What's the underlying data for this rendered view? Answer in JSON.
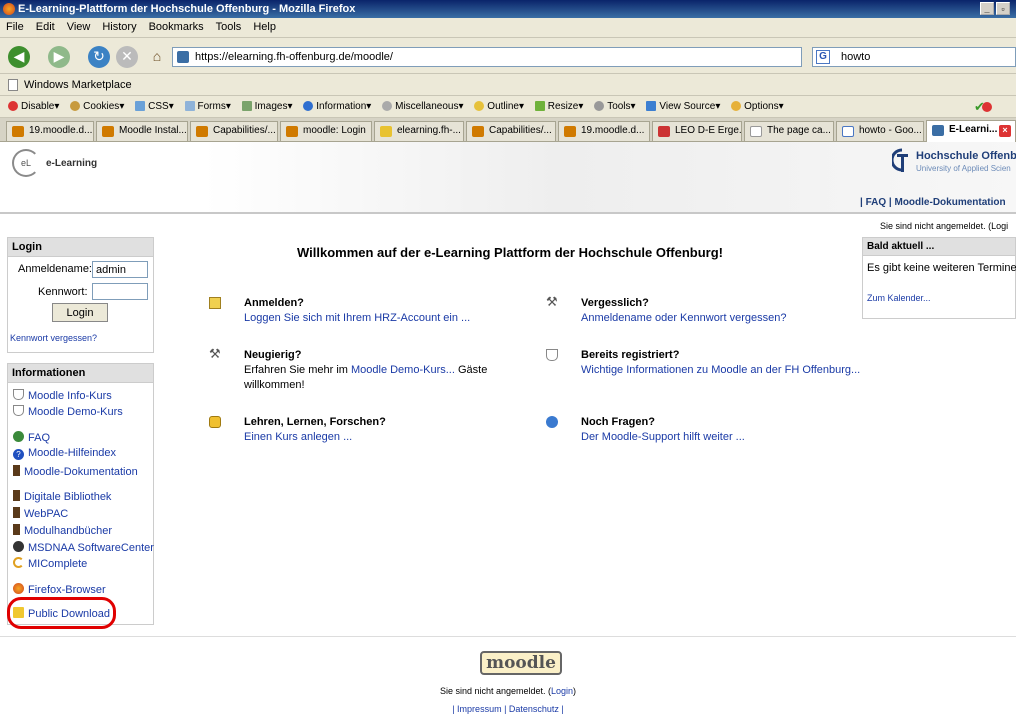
{
  "window": {
    "title": "E-Learning-Plattform der Hochschule Offenburg - Mozilla Firefox"
  },
  "menu": [
    "File",
    "Edit",
    "View",
    "History",
    "Bookmarks",
    "Tools",
    "Help"
  ],
  "nav": {
    "url": "https://elearning.fh-offenburg.de/moodle/",
    "search_value": "howto"
  },
  "bookmarks": {
    "item": "Windows Marketplace"
  },
  "devbar": [
    "Disable",
    "Cookies",
    "CSS",
    "Forms",
    "Images",
    "Information",
    "Miscellaneous",
    "Outline",
    "Resize",
    "Tools",
    "View Source",
    "Options"
  ],
  "tabs": [
    "19.moodle.d...",
    "Moodle Instal...",
    "Capabilities/...",
    "moodle: Login",
    "elearning.fh-...",
    "Capabilities/...",
    "19.moodle.d...",
    "LEO D-E Erge...",
    "The page ca...",
    "howto - Goo...",
    "E-Learni..."
  ],
  "header": {
    "logo_text": "e-Learning",
    "logo_mark": "eL",
    "school_name": "Hochschule Offenbu",
    "school_sub": "University of Applied Scien",
    "topnav": "|  FAQ   |   Moodle-Dokumentation",
    "login_status": "Sie sind nicht angemeldet. (Logi"
  },
  "login": {
    "title": "Login",
    "user_label": "Anmeldename:",
    "user_value": "admin",
    "pass_label": "Kennwort:",
    "button": "Login",
    "forgot": "Kennwort vergessen?"
  },
  "info": {
    "title": "Informationen",
    "links": [
      "Moodle Info-Kurs",
      "Moodle Demo-Kurs",
      "FAQ",
      "Moodle-Hilfeindex",
      "Moodle-Dokumentation",
      "Digitale Bibliothek",
      "WebPAC",
      "Modulhandbücher",
      "MSDNAA SoftwareCenter",
      "MIComplete",
      "Firefox-Browser",
      "Public Download"
    ]
  },
  "main": {
    "welcome": "Willkommen auf der e-Learning Plattform der Hochschule Offenburg!",
    "items": [
      {
        "title": "Anmelden?",
        "text": "Loggen Sie sich mit Ihrem HRZ-Account ein ..."
      },
      {
        "title": "Vergesslich?",
        "text": "Anmeldename oder Kennwort vergessen?"
      },
      {
        "title": "Neugierig?",
        "text_pre": "Erfahren Sie mehr im ",
        "link": "Moodle Demo-Kurs...",
        "text_post": " Gäste",
        "text_line2": "willkommen!"
      },
      {
        "title": "Bereits registriert?",
        "text": "Wichtige Informationen zu Moodle an der FH Offenburg..."
      },
      {
        "title": "Lehren, Lernen, Forschen?",
        "text": "Einen Kurs anlegen ..."
      },
      {
        "title": "Noch Fragen?",
        "text": "Der Moodle-Support hilft weiter ..."
      }
    ]
  },
  "calendar": {
    "title": "Bald aktuell ...",
    "text": "Es gibt keine weiteren Termine",
    "link": "Zum Kalender..."
  },
  "footer": {
    "logo": "moodle",
    "status_pre": "Sie sind nicht angemeldet. (",
    "status_link": "Login",
    "status_post": ")",
    "links": "| Impressum | Datenschutz |"
  },
  "colors": {
    "link": "#1a3aa6",
    "highlight": "#e00000",
    "school": "#1f3e78"
  }
}
